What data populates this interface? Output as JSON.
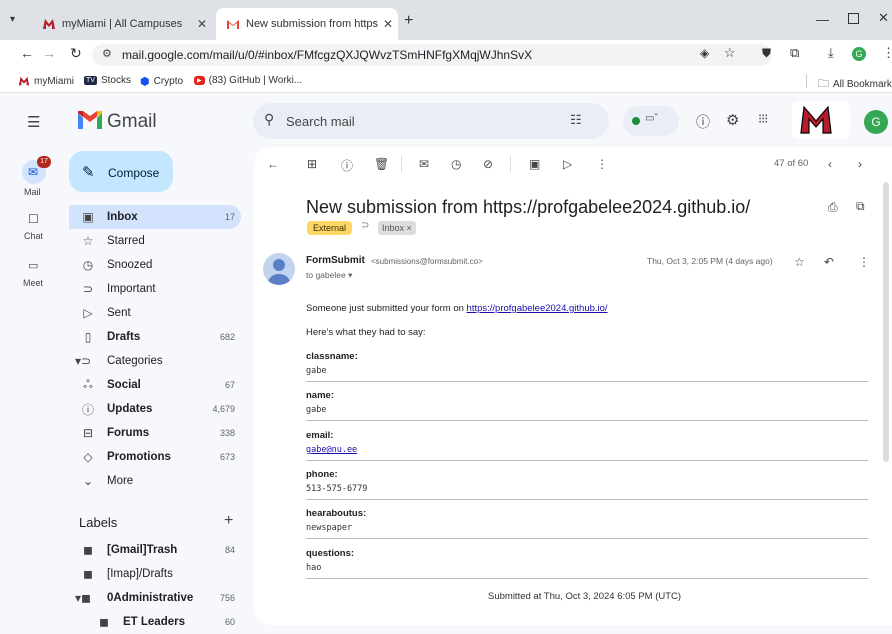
{
  "browser": {
    "tabs": [
      {
        "title": "myMiami | All Campuses",
        "active": false
      },
      {
        "title": "New submission from https://p",
        "active": true
      }
    ],
    "new_tab": "+",
    "url": "mail.google.com/mail/u/0/#inbox/FMfcgzQXJQWvzTSmHNFfgXMqjWJhnSvX",
    "bookmarks": [
      "myMiami",
      "Stocks",
      "Crypto",
      "(83) GitHub | Worki..."
    ],
    "all_bookmarks": "All Bookmarks"
  },
  "gmail": {
    "logo_text": "Gmail",
    "search_placeholder": "Search mail",
    "avatar_letter": "G",
    "rail": [
      {
        "label": "Mail",
        "badge": "17"
      },
      {
        "label": "Chat"
      },
      {
        "label": "Meet"
      }
    ],
    "compose": "Compose",
    "nav": [
      {
        "label": "Inbox",
        "count": "17",
        "bold": true,
        "active": true
      },
      {
        "label": "Starred",
        "count": ""
      },
      {
        "label": "Snoozed",
        "count": ""
      },
      {
        "label": "Important",
        "count": ""
      },
      {
        "label": "Sent",
        "count": ""
      },
      {
        "label": "Drafts",
        "count": "682",
        "bold": true
      },
      {
        "label": "Categories",
        "count": ""
      },
      {
        "label": "Social",
        "count": "67",
        "bold": true
      },
      {
        "label": "Updates",
        "count": "4,679",
        "bold": true
      },
      {
        "label": "Forums",
        "count": "338",
        "bold": true
      },
      {
        "label": "Promotions",
        "count": "673",
        "bold": true
      },
      {
        "label": "More",
        "count": ""
      }
    ],
    "labels_heading": "Labels",
    "labels": [
      {
        "label": "[Gmail]Trash",
        "count": "84",
        "bold": true
      },
      {
        "label": "[Imap]/Drafts",
        "count": ""
      },
      {
        "label": "0Administrative",
        "count": "756",
        "bold": true
      },
      {
        "label": "ET Leaders",
        "count": "60",
        "bold": true
      }
    ],
    "pagination": "47 of 60",
    "email": {
      "subject": "New submission from https://profgabelee2024.github.io/",
      "tag_external": "External",
      "tag_inbox": "Inbox ×",
      "sender_name": "FormSubmit",
      "sender_email": "<submissions@formsubmit.co>",
      "to": "to gabelee ▾",
      "date": "Thu, Oct 3, 2:05 PM (4 days ago)",
      "intro_prefix": "Someone just submitted your form on ",
      "intro_link": "https://profgabelee2024.github.io/",
      "intro2": "Here's what they had to say:",
      "fields": [
        {
          "label": "classname:",
          "value": "gabe"
        },
        {
          "label": "name:",
          "value": "gabe"
        },
        {
          "label": "email:",
          "value": "gabe@nu.ee"
        },
        {
          "label": "phone:",
          "value": "513-575-6779"
        },
        {
          "label": "hearaboutus:",
          "value": "newspaper"
        },
        {
          "label": "questions:",
          "value": "hao"
        }
      ],
      "footer": "Submitted at Thu, Oct 3, 2024 6:05 PM (UTC)"
    }
  }
}
